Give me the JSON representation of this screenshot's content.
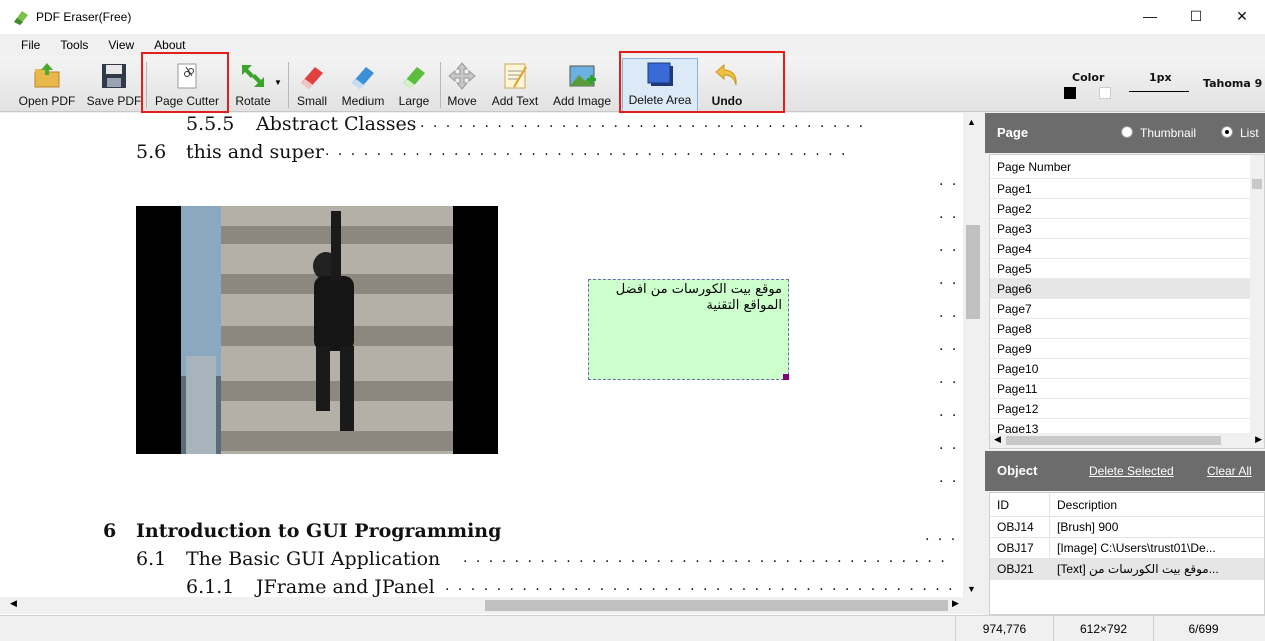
{
  "window": {
    "title": "PDF Eraser(Free)",
    "controls": {
      "minimize": "—",
      "maximize": "☐",
      "close": "✕"
    }
  },
  "menu": [
    "File",
    "Tools",
    "View",
    "About"
  ],
  "toolbar": {
    "open": "Open PDF",
    "save": "Save PDF",
    "page_cutter": "Page Cutter",
    "rotate": "Rotate",
    "small": "Small",
    "medium": "Medium",
    "large": "Large",
    "move": "Move",
    "add_text": "Add Text",
    "add_image": "Add Image",
    "delete_area": "Delete Area",
    "undo": "Undo",
    "color_label": "Color",
    "size_label": "1px",
    "font_label": "Tahoma 9"
  },
  "document": {
    "lines": [
      {
        "num": "5.5.5",
        "text": "Abstract Classes"
      },
      {
        "num": "5.6",
        "text": "this and super"
      }
    ],
    "chapter_num": "6",
    "chapter_title": "Introduction to GUI Programming",
    "sub1_num": "6.1",
    "sub1_text": "The Basic GUI Application",
    "sub2_num": "6.1.1",
    "sub2_text": "JFrame and JPanel",
    "text_box": "موقع بيت الكورسات من افضل المواقع التقنية"
  },
  "page_panel": {
    "title": "Page",
    "opt_thumbnail": "Thumbnail",
    "opt_list": "List",
    "selected_view": "List",
    "header": "Page Number",
    "pages": [
      "Page1",
      "Page2",
      "Page3",
      "Page4",
      "Page5",
      "Page6",
      "Page7",
      "Page8",
      "Page9",
      "Page10",
      "Page11",
      "Page12",
      "Page13"
    ],
    "selected_page": "Page6"
  },
  "object_panel": {
    "title": "Object",
    "delete_selected": "Delete Selected",
    "clear_all": "Clear All",
    "col_id": "ID",
    "col_desc": "Description",
    "rows": [
      {
        "id": "OBJ14",
        "desc": "[Brush] 900"
      },
      {
        "id": "OBJ17",
        "desc": "[Image] C:\\Users\\trust01\\De..."
      },
      {
        "id": "OBJ21",
        "desc": "[Text] موقع بيت الكورسات من..."
      }
    ]
  },
  "status": {
    "coords": "974,776",
    "page_size": "612×792",
    "page_index": "6/699"
  }
}
